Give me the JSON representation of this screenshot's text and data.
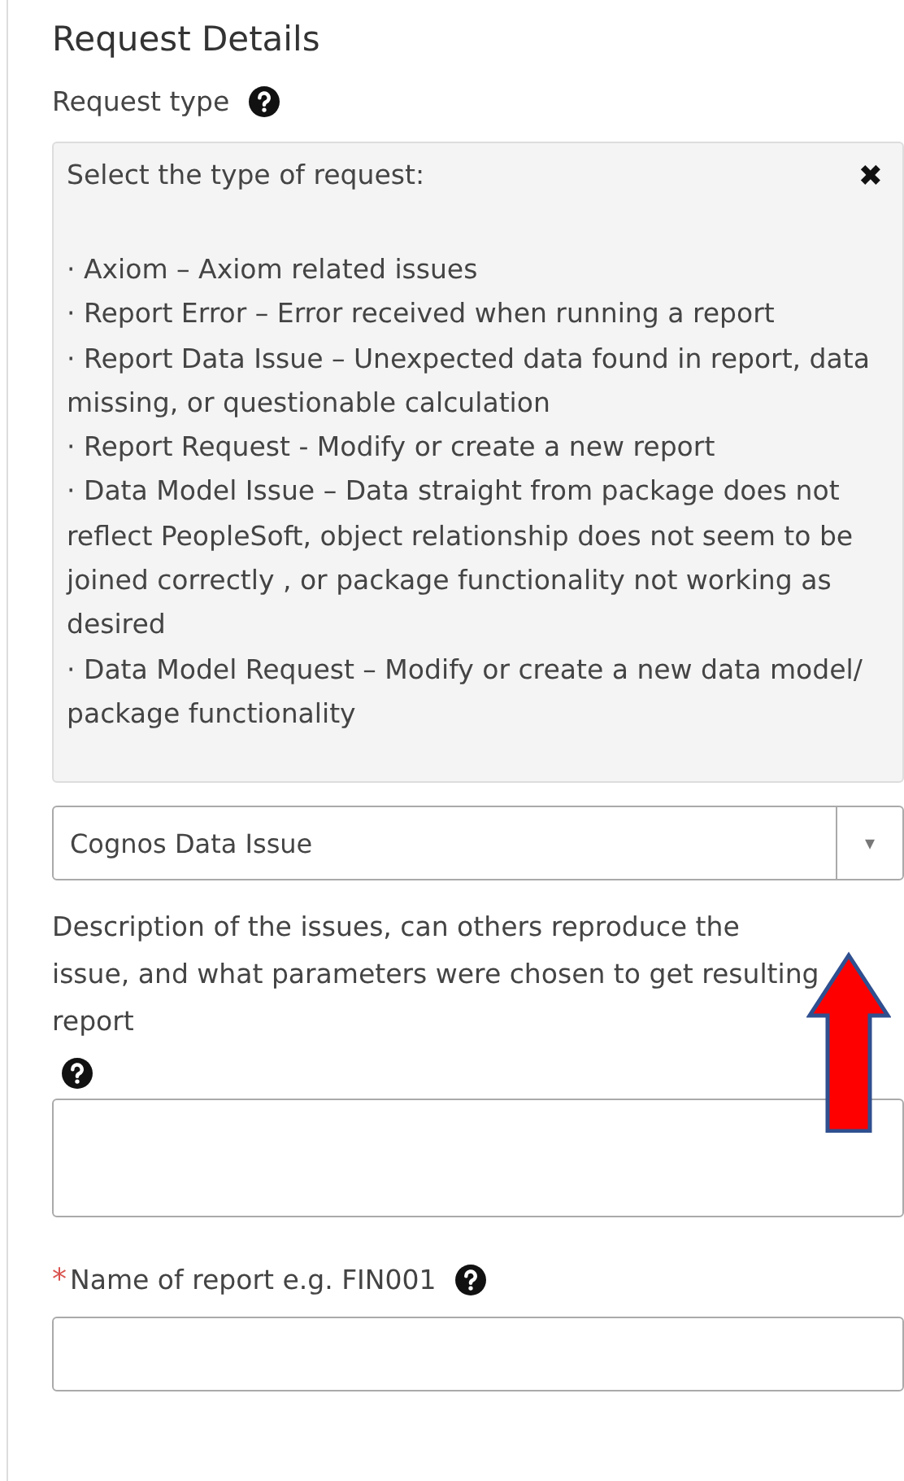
{
  "section_title": "Request Details",
  "request_type": {
    "label": "Request type",
    "help": true,
    "tooltip": {
      "intro": "Select the type of request:",
      "close": "✖",
      "items": [
        "· Axiom – Axiom related issues",
        "· Report Error – Error received when running a report",
        "· Report Data Issue – Unexpected data found in report, data missing, or questionable calculation",
        "· Report Request - Modify or create a new report",
        "· Data Model Issue – Data straight from package does not reflect PeopleSoft, object relationship does not seem to be joined correctly , or package functionality not working as desired",
        "· Data Model Request – Modify or create a new data model/ package functionality"
      ]
    },
    "value": "Cognos Data Issue",
    "caret": "▾"
  },
  "fields": [
    {
      "kind": "textarea",
      "label": "Description of the issues, can others reproduce the issue, and what parameters were chosen to get resulting report",
      "help": true
    },
    {
      "kind": "input",
      "label": "Name of report e.g. FIN001",
      "required_mark": "*",
      "help": true
    }
  ]
}
